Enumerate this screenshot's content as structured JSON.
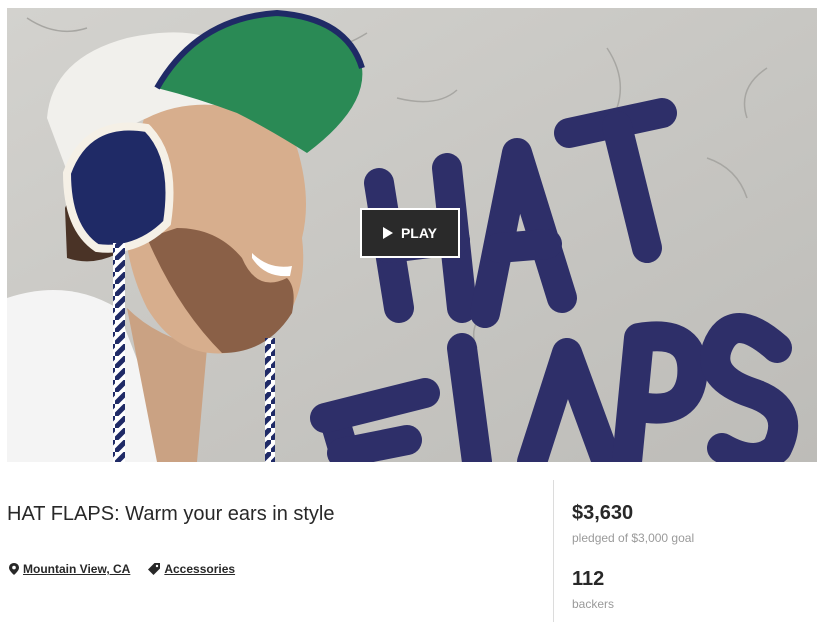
{
  "video": {
    "play_label": "PLAY",
    "overlay_text_line1": "HAT",
    "overlay_text_line2": "FLAPS",
    "overlay_text_color": "#2e2f69"
  },
  "project": {
    "title": "HAT FLAPS: Warm your ears in style",
    "location": "Mountain View, CA",
    "category": "Accessories"
  },
  "stats": {
    "pledged": "$3,630",
    "pledged_label": "pledged of $3,000 goal",
    "backers": "112",
    "backers_label": "backers"
  },
  "icons": {
    "location": "map-pin-icon",
    "category": "tag-icon",
    "play": "play-icon"
  }
}
